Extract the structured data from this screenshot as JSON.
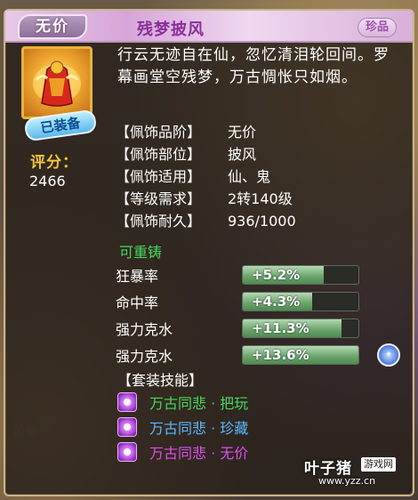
{
  "header": {
    "rarity": "无价",
    "item_name": "残梦披风",
    "quality": "珍品"
  },
  "item": {
    "equipped_label": "已装备",
    "score_label": "评分：",
    "score_value": "2466"
  },
  "description": "行云无迹自在仙，忽忆清泪轮回间。罗幕画堂空残梦，万古惆怅只如烟。",
  "attributes": [
    {
      "key": "【佩饰品阶】",
      "value": "无价"
    },
    {
      "key": "【佩饰部位】",
      "value": "披风"
    },
    {
      "key": "【佩饰适用】",
      "value": "仙、鬼"
    },
    {
      "key": "【等级需求】",
      "value": "2转140级"
    },
    {
      "key": "【佩饰耐久】",
      "value": "936/1000"
    }
  ],
  "reforge_label": "可重铸",
  "stats": [
    {
      "name": "狂暴率",
      "value": "+5.2%",
      "fill": 0.7
    },
    {
      "name": "命中率",
      "value": "+4.3%",
      "fill": 0.6
    },
    {
      "name": "强力克水",
      "value": "+11.3%",
      "fill": 0.85
    },
    {
      "name": "强力克水",
      "value": "+13.6%",
      "fill": 1.0
    }
  ],
  "extra_icon": "extra-attribute-icon",
  "set_skill_title": "【套装技能】",
  "set_skills": [
    {
      "name": "万古同悲 · 把玩",
      "color": "#46d95a"
    },
    {
      "name": "万古同悲 · 珍藏",
      "color": "#5bb8ff"
    },
    {
      "name": "万古同悲 · 无价",
      "color": "#e04ef0"
    }
  ],
  "background": {
    "equip_label": "装备"
  },
  "watermark": {
    "brand": "叶子猪",
    "tag": "游戏网",
    "url": "www.yzz.cn"
  },
  "colors": {
    "rarity_purple": "#8a2f9a",
    "score_gold": "#f3c63a",
    "reforge_green": "#46d95a",
    "stat_bar_green": "#6ba46b"
  }
}
